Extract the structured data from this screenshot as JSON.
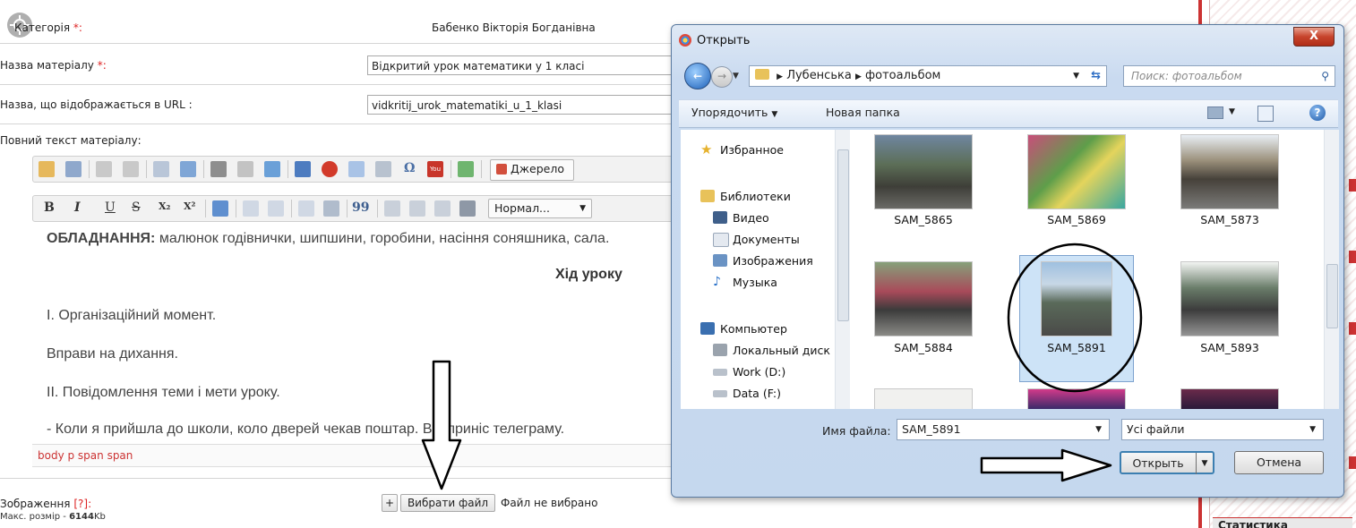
{
  "form": {
    "category_label": "Категорія",
    "category_value": "Бабенко Вікторія Богданівна",
    "title_label": "Назва матеріалу",
    "title_value": "Відкритий урок математики у 1 класі",
    "url_label": "Назва, що відображається в URL :",
    "url_value": "vidkritij_urok_matematiki_u_1_klasi",
    "fulltext_label": "Повний текст матеріалу:",
    "required_mark": "*:",
    "source_button": "Джерело",
    "format_select": "Нормал...",
    "image_label": "Зображення",
    "image_help": "[?]:",
    "max_size_label": "Макс. розмір -",
    "max_size_value": "6144",
    "max_size_unit": "Kb",
    "add_button": "+",
    "choose_file_button": "Вибрати файл",
    "no_file_text": "Файл не вибрано",
    "path_bar": "body  p  span  span"
  },
  "editor": {
    "equipment_label": "ОБЛАДНАННЯ:",
    "equipment_text": " малюнок годівнички, шипшини, горобини, насіння соняшника, сала.",
    "heading": "Хід уроку",
    "line1": "І. Організаційний момент.",
    "line2": "Вправи на дихання.",
    "line3": "ІІ. Повідомлення теми і мети уроку.",
    "line4": "- Коли я прийшла до школи, коло дверей чекав поштар. Він приніс телеграму."
  },
  "toolbar_bold": "B",
  "toolbar_italic": "I",
  "toolbar_underline": "U",
  "toolbar_strike": "S",
  "toolbar_sub": "X₂",
  "toolbar_sup": "X²",
  "toolbar_omega": "Ω",
  "toolbar_youtube": "You",
  "toolbar_quote": "99",
  "sidebar": {
    "bottom_label": "Статистика"
  },
  "dialog": {
    "title": "Открыть",
    "close": "X",
    "breadcrumb": [
      "Лубенська",
      "фотоальбом"
    ],
    "search_placeholder": "Поиск: фотоальбом",
    "organize": "Упорядочить",
    "new_folder": "Новая папка",
    "nav": {
      "favorites": "Избранное",
      "libraries": "Библиотеки",
      "video": "Видео",
      "documents": "Документы",
      "images": "Изображения",
      "music": "Музыка",
      "computer": "Компьютер",
      "local_disk": "Локальный диск",
      "work": "Work (D:)",
      "data": "Data (F:)"
    },
    "files": [
      "SAM_5865",
      "SAM_5869",
      "SAM_5873",
      "SAM_5884",
      "SAM_5891",
      "SAM_5893"
    ],
    "selected_file": "SAM_5891",
    "filename_label": "Имя файла:",
    "filename_value": "SAM_5891",
    "filter_value": "Усі файли",
    "open_button": "Открыть",
    "cancel_button": "Отмена"
  },
  "colors": {
    "required": "#dd2222",
    "selection": "#cde3f7",
    "dialog_frame": "#c5d8ee",
    "close_button": "#c7442c"
  }
}
